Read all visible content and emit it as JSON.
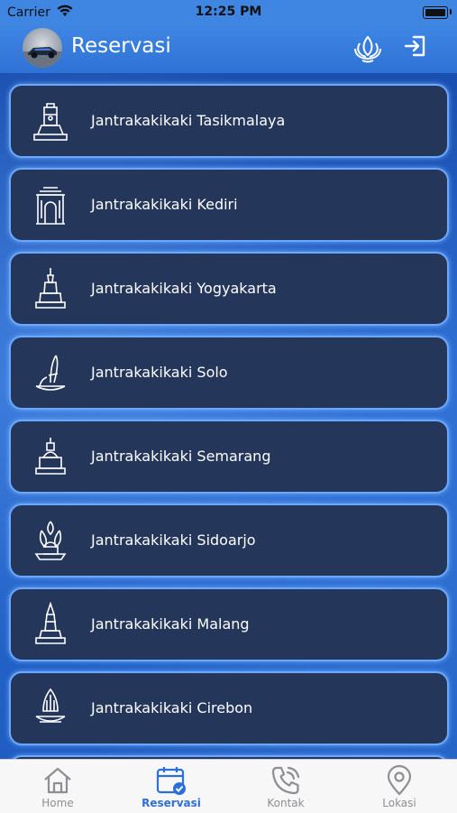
{
  "status_bar": {
    "carrier": "Carrier",
    "time": "12:25 PM"
  },
  "header": {
    "title": "Reservasi"
  },
  "locations": [
    {
      "label": "Jantrakakikaki Tasikmalaya",
      "icon": "tasikmalaya-monument-icon"
    },
    {
      "label": "Jantrakakikaki Kediri",
      "icon": "kediri-gate-icon"
    },
    {
      "label": "Jantrakakikaki Yogyakarta",
      "icon": "yogyakarta-tugu-icon"
    },
    {
      "label": "Jantrakakikaki Solo",
      "icon": "solo-monument-icon"
    },
    {
      "label": "Jantrakakikaki Semarang",
      "icon": "semarang-monument-icon"
    },
    {
      "label": "Jantrakakikaki Sidoarjo",
      "icon": "sidoarjo-monument-icon"
    },
    {
      "label": "Jantrakakikaki Malang",
      "icon": "malang-monument-icon"
    },
    {
      "label": "Jantrakakikaki Cirebon",
      "icon": "cirebon-monument-icon"
    }
  ],
  "tabs": [
    {
      "label": "Home",
      "icon": "home-icon",
      "active": false
    },
    {
      "label": "Reservasi",
      "icon": "calendar-check-icon",
      "active": true
    },
    {
      "label": "Kontak",
      "icon": "phone-icon",
      "active": false
    },
    {
      "label": "Lokasi",
      "icon": "location-pin-icon",
      "active": false
    }
  ],
  "colors": {
    "accent": "#2d6fd9",
    "card_bg": "#243659",
    "card_border": "#6aa8ff",
    "tab_inactive": "#8e8e93"
  }
}
